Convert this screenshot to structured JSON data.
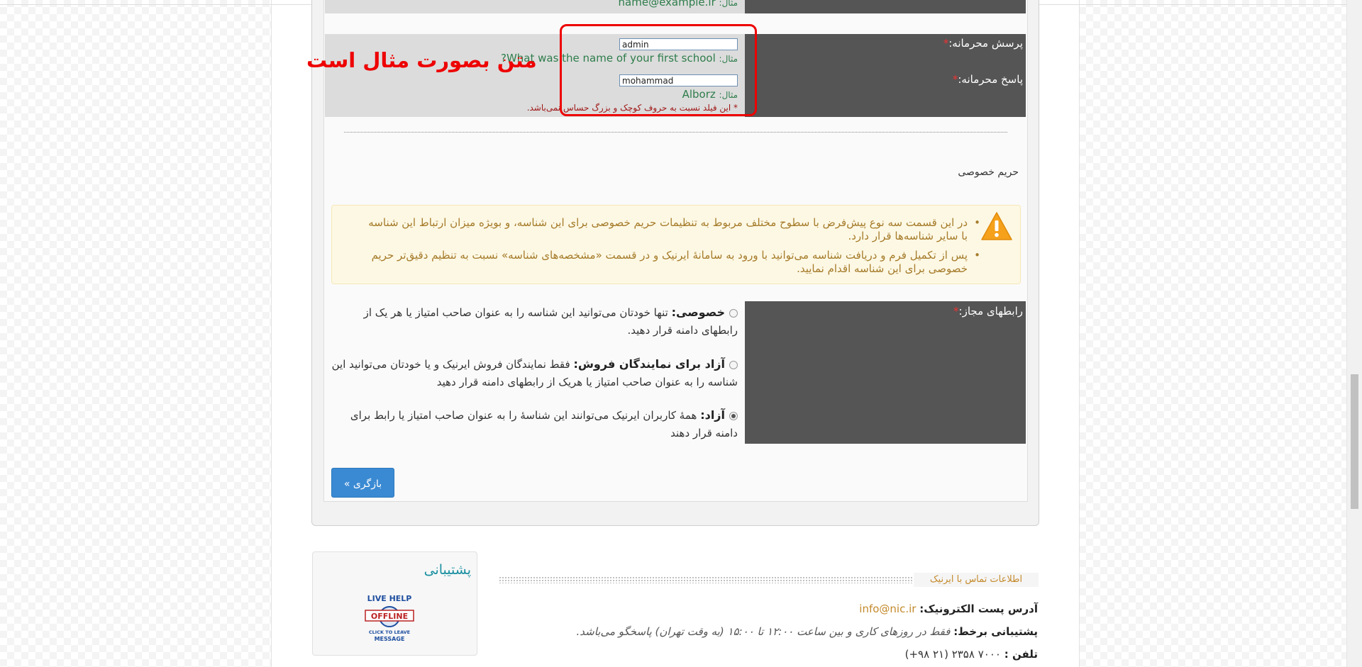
{
  "form": {
    "email_example_prefix": "مثال:",
    "email_example_value": "name@example.ir",
    "security_question": {
      "label": "پرسش محرمانه:",
      "required_mark": "*",
      "value": "admin",
      "example_prefix": "مثال:",
      "example_value": "What was the name of your first school?"
    },
    "security_answer": {
      "label": "پاسخ محرمانه:",
      "required_mark": "*",
      "value": "mohammad",
      "example_prefix": "مثال:",
      "example_value": "Alborz",
      "case_note": "* این فیلد نسبت به حروف کوچک و بزرگ حساس نمی‌باشد."
    },
    "annotation": "متن بصورت مثال است",
    "privacy": {
      "title": "حریم خصوصی",
      "notes": [
        "در این قسمت سه نوع پیش‌فرض با سطوح مختلف مربوط به تنظیمات حریم خصوصی برای این شناسه، و بویژه میزان ارتباط این شناسه با سایر شناسه‌ها قرار دارد.",
        "پس از تکمیل فرم و دریافت شناسه می‌توانید با ورود به سامانهٔ ایرنیک و در قسمت «مشخصه‌های شناسه» نسبت به تنظیم دقیق‌تر حریم خصوصی برای این شناسه اقدام نمایید."
      ]
    },
    "allowed_contacts": {
      "label": "رابطهای مجاز:",
      "required_mark": "*",
      "options": [
        {
          "title": "خصوصی:",
          "desc": "تنها خودتان می‌توانید این شناسه را به عنوان صاحب امتیاز یا هر یک از رابطهای دامنه قرار دهید."
        },
        {
          "title": "آزاد برای نمایندگان فروش:",
          "desc": "فقط نمایندگان فروش ایرنیک و یا خودتان می‌توانید این شناسه را به عنوان صاحب امتیاز یا هریک از رابطهای دامنه قرار دهید"
        },
        {
          "title": "آزاد:",
          "desc": "همهٔ کاربران ایرنیک می‌توانند این شناسهٔ را به عنوان صاحب امتیاز یا رابط برای دامنه قرار دهند"
        }
      ],
      "selected_index": 2
    },
    "back_button": "بازگری »"
  },
  "footer": {
    "support_title": "پشتیبانی",
    "livehelp": {
      "top": "LIVE HELP",
      "status": "OFFLINE",
      "line1": "CLICK TO LEAVE",
      "line2": "MESSAGE"
    },
    "contact_title": "اطلاعات تماس با ایرنیک",
    "email_label": "آدرس پست الکترونیک:",
    "email_value": "info@nic.ir",
    "online_label": "پشتیبانی برخط:",
    "online_value": "فقط در روزهای کاری و بین ساعت ۱۲:۰۰ تا ۱۵:۰۰ (به وقت تهران) پاسخگو می‌باشد.",
    "phone_label": "تلفن :",
    "phone_value": "۷۰۰۰ ۲۳۵۸ (۲۱ ۹۸+)"
  },
  "colors": {
    "dark_label_bg": "#555555",
    "accent_blue": "#3a8ad3",
    "annotation_red": "#ee0000",
    "warning_text": "#a57b2a",
    "example_green": "#2e7d4b"
  }
}
